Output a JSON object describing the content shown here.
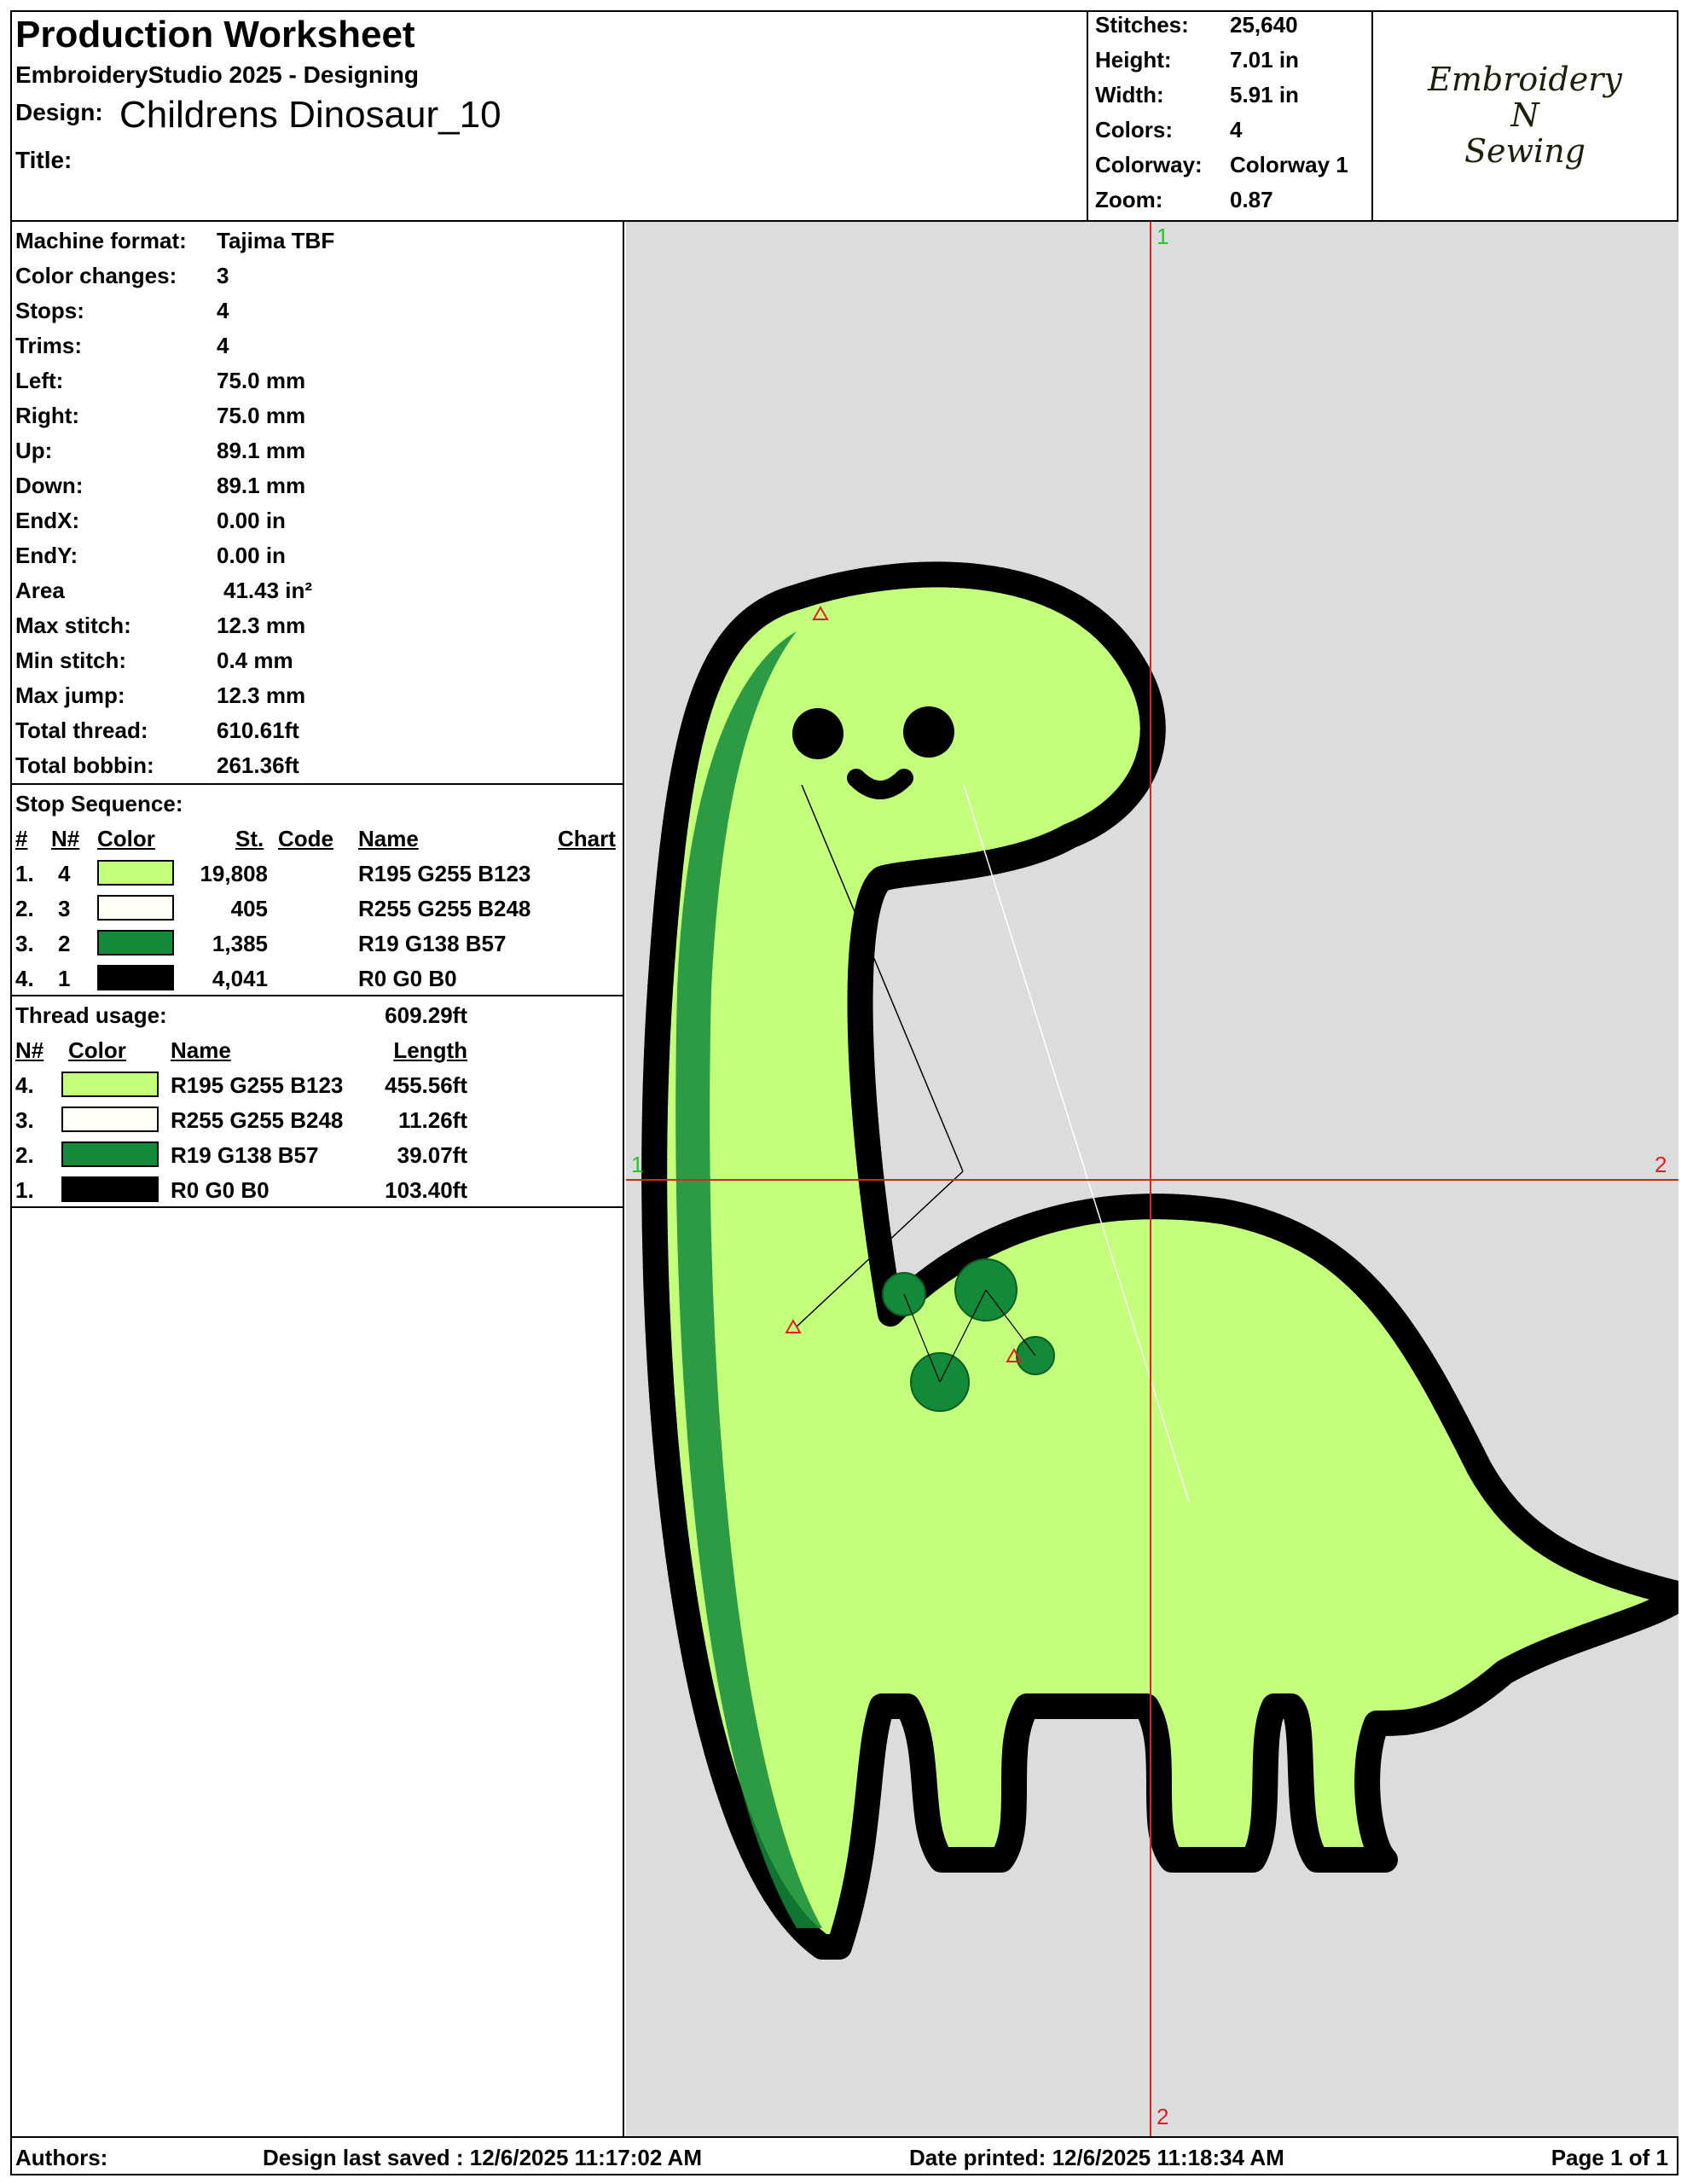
{
  "header": {
    "title": "Production Worksheet",
    "subtitle": "EmbroideryStudio 2025 - Designing",
    "design_label": "Design:",
    "design_name": "Childrens Dinosaur_10",
    "title_label": "Title:",
    "stats": [
      {
        "label": "Stitches:",
        "value": "25,640"
      },
      {
        "label": "Height:",
        "value": "7.01 in"
      },
      {
        "label": "Width:",
        "value": "5.91 in"
      },
      {
        "label": "Colors:",
        "value": "4"
      },
      {
        "label": "Colorway:",
        "value": "Colorway 1"
      },
      {
        "label": "Zoom:",
        "value": "0.87"
      }
    ],
    "logo": {
      "line1": "Embroidery",
      "line2": "N",
      "line3": "Sewing"
    }
  },
  "machine_info": [
    {
      "label": "Machine format:",
      "value": "Tajima TBF"
    },
    {
      "label": "Color changes:",
      "value": "3"
    },
    {
      "label": "Stops:",
      "value": "4"
    },
    {
      "label": "Trims:",
      "value": "4"
    },
    {
      "label": "Left:",
      "value": "75.0 mm"
    },
    {
      "label": "Right:",
      "value": "75.0 mm"
    },
    {
      "label": "Up:",
      "value": "89.1 mm"
    },
    {
      "label": "Down:",
      "value": "89.1 mm"
    },
    {
      "label": "EndX:",
      "value": "0.00 in"
    },
    {
      "label": "EndY:",
      "value": "0.00 in"
    },
    {
      "label": "Area",
      "value": "41.43 in²"
    },
    {
      "label": "Max stitch:",
      "value": "12.3 mm"
    },
    {
      "label": "Min stitch:",
      "value": "0.4 mm"
    },
    {
      "label": "Max jump:",
      "value": "12.3 mm"
    },
    {
      "label": "Total thread:",
      "value": "610.61ft"
    },
    {
      "label": "Total bobbin:",
      "value": "261.36ft"
    }
  ],
  "stop_sequence": {
    "title": "Stop Sequence:",
    "headers": {
      "num": "#",
      "n": "N#",
      "color": "Color",
      "st": "St.",
      "code": "Code",
      "name": "Name",
      "chart": "Chart"
    },
    "rows": [
      {
        "num": "1.",
        "n": "4",
        "color": "#c3ff7b",
        "st": "19,808",
        "code": "",
        "name": "R195 G255 B123"
      },
      {
        "num": "2.",
        "n": "3",
        "color": "#fffff8",
        "st": "405",
        "code": "",
        "name": "R255 G255 B248"
      },
      {
        "num": "3.",
        "n": "2",
        "color": "#138a39",
        "st": "1,385",
        "code": "",
        "name": "R19 G138 B57"
      },
      {
        "num": "4.",
        "n": "1",
        "color": "#000000",
        "st": "4,041",
        "code": "",
        "name": "R0 G0 B0"
      }
    ]
  },
  "thread_usage": {
    "title": "Thread usage:",
    "total": "609.29ft",
    "headers": {
      "n": "N#",
      "color": "Color",
      "name": "Name",
      "length": "Length"
    },
    "rows": [
      {
        "n": "4.",
        "color": "#c3ff7b",
        "name": "R195 G255 B123",
        "length": "455.56ft"
      },
      {
        "n": "3.",
        "color": "#fffff8",
        "name": "R255 G255 B248",
        "length": "11.26ft"
      },
      {
        "n": "2.",
        "color": "#138a39",
        "name": "R19 G138 B57",
        "length": "39.07ft"
      },
      {
        "n": "1.",
        "color": "#000000",
        "name": "R0 G0 B0",
        "length": "103.40ft"
      }
    ]
  },
  "canvas": {
    "axis_top": "1",
    "axis_bottom": "2",
    "axis_left": "1",
    "axis_right": "2",
    "axis_color": "#e02020",
    "label_green": "#22cc22",
    "label_red": "#e02020",
    "background": "#dcdcdc"
  },
  "footer": {
    "authors_label": "Authors:",
    "saved": "Design last saved : 12/6/2025 11:17:02 AM",
    "printed": "Date printed: 12/6/2025 11:18:34 AM",
    "page": "Page 1 of 1"
  }
}
